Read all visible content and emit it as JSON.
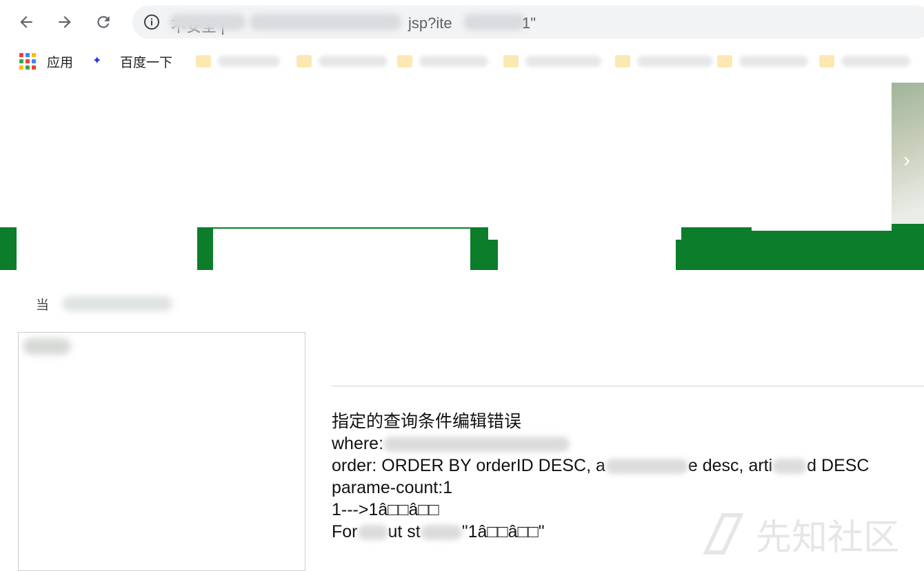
{
  "browser": {
    "address_visible_text": "不安全 | ",
    "url_fragment": "jsp?ite",
    "url_end": "1\"",
    "nav": {
      "back_icon": "arrow-left-icon",
      "forward_icon": "arrow-right-icon",
      "reload_icon": "reload-icon",
      "info_icon": "info-icon"
    }
  },
  "bookmarks": {
    "apps_label": "应用",
    "baidu_label": "百度一下"
  },
  "page": {
    "breadcrumb_start": "当"
  },
  "error": {
    "line1": "指定的查询条件编辑错误",
    "where_label": "where:",
    "order_prefix": "order: ORDER BY orderID DESC, a",
    "order_mid": "e desc, arti",
    "order_suffix": "d DESC",
    "parame_count": "parame-count:1",
    "mapping": "1--->1â□□â□□",
    "for_prefix": "For",
    "for_mid": "ut st",
    "for_suffix": "\"1â□□â□□\""
  },
  "watermark": {
    "text": "先知社区"
  },
  "colors": {
    "banner_green": "#0b7d2b",
    "omnibox_bg": "#f1f3f4"
  }
}
